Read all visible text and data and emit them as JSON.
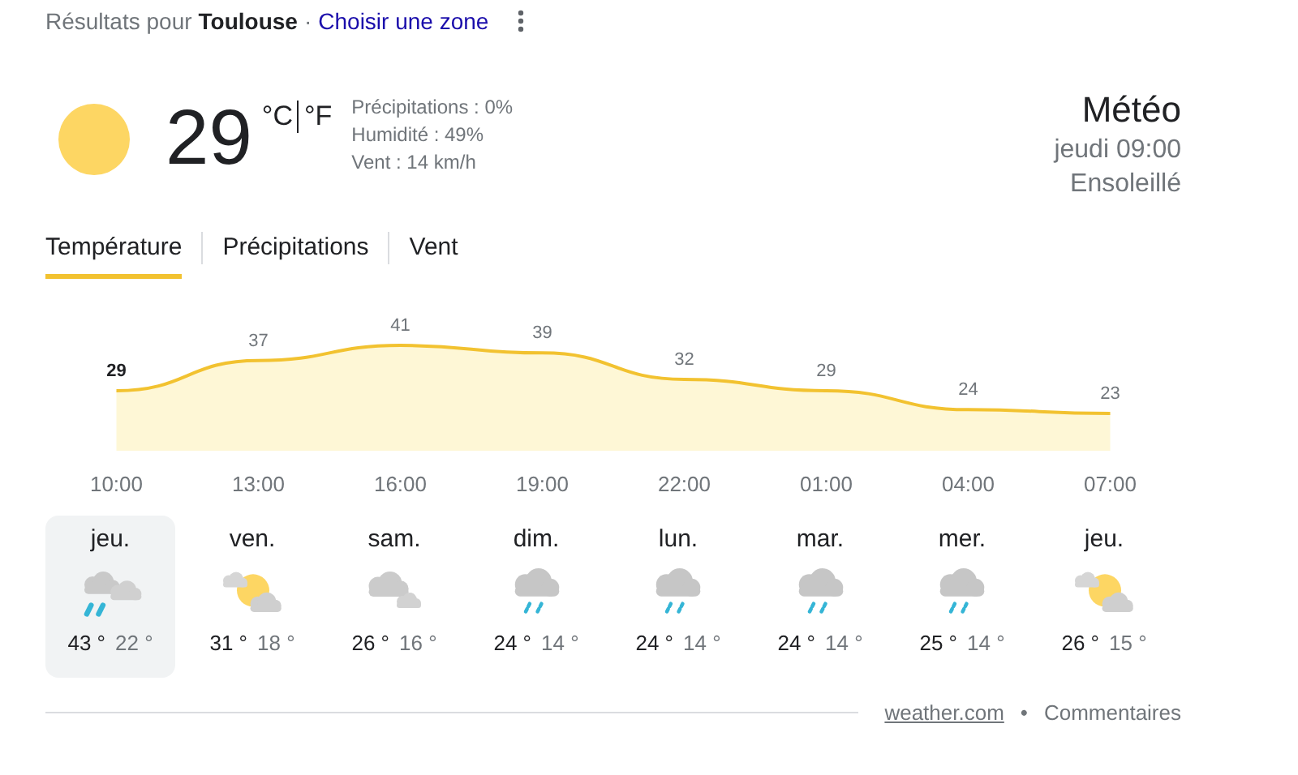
{
  "header": {
    "prefix": "Résultats pour",
    "location": "Toulouse",
    "separator": "·",
    "change_link": "Choisir une zone"
  },
  "current": {
    "temperature": "29",
    "units": [
      "°C",
      "°F"
    ],
    "details": [
      "Précipitations : 0%",
      "Humidité : 49%",
      "Vent : 14 km/h"
    ]
  },
  "summary": {
    "title": "Météo",
    "time": "jeudi 09:00",
    "condition": "Ensoleillé"
  },
  "tabs": [
    {
      "label": "Température",
      "selected": true
    },
    {
      "label": "Précipitations",
      "selected": false
    },
    {
      "label": "Vent",
      "selected": false
    }
  ],
  "chart_data": {
    "type": "area",
    "categories": [
      "10:00",
      "13:00",
      "16:00",
      "19:00",
      "22:00",
      "01:00",
      "04:00",
      "07:00"
    ],
    "values": [
      29,
      37,
      41,
      39,
      32,
      29,
      24,
      23
    ],
    "data_labels": true
  },
  "forecast": [
    {
      "day": "jeu.",
      "kind": "heavy-rain",
      "high": "43 °",
      "low": "22 °",
      "selected": true
    },
    {
      "day": "ven.",
      "kind": "partly-sunny",
      "high": "31 °",
      "low": "18 °",
      "selected": false
    },
    {
      "day": "sam.",
      "kind": "cloudy",
      "high": "26 °",
      "low": "16 °",
      "selected": false
    },
    {
      "day": "dim.",
      "kind": "showers",
      "high": "24 °",
      "low": "14 °",
      "selected": false
    },
    {
      "day": "lun.",
      "kind": "showers",
      "high": "24 °",
      "low": "14 °",
      "selected": false
    },
    {
      "day": "mar.",
      "kind": "showers",
      "high": "24 °",
      "low": "14 °",
      "selected": false
    },
    {
      "day": "mer.",
      "kind": "showers",
      "high": "25 °",
      "low": "14 °",
      "selected": false
    },
    {
      "day": "jeu.",
      "kind": "partly-sunny",
      "high": "26 °",
      "low": "15 °",
      "selected": false
    }
  ],
  "footer": {
    "source": "weather.com",
    "separator": "•",
    "feedback": "Commentaires"
  }
}
